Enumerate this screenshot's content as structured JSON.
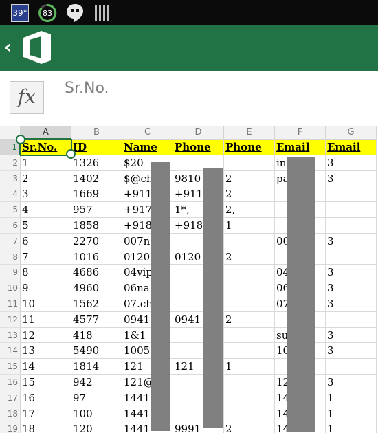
{
  "status_bar": {
    "temperature": "39°",
    "battery_level": "83",
    "icons": [
      "hangouts-icon",
      "signal-bars-icon"
    ]
  },
  "app_bar": {
    "back_icon": "chevron-left-icon",
    "logo_icon": "office-logo-icon",
    "color": "#217346"
  },
  "formula_bar": {
    "fx_label": "fx",
    "value": "Sr.No."
  },
  "sheet": {
    "columns": [
      "A",
      "B",
      "C",
      "D",
      "E",
      "F",
      "G"
    ],
    "active_column": "A",
    "active_row": "1",
    "header_fill": "#ffff00",
    "rows": [
      {
        "num": "1",
        "cells": [
          "Sr.No.",
          "ID",
          "Name",
          "Phone",
          "Phone",
          "Email",
          "Email"
        ]
      },
      {
        "num": "2",
        "cells": [
          "1",
          "1326",
          "$20",
          "",
          "",
          "in",
          "3"
        ]
      },
      {
        "num": "3",
        "cells": [
          "2",
          "1402",
          "$@ch",
          "9810",
          "2",
          "pa",
          "3"
        ]
      },
      {
        "num": "4",
        "cells": [
          "3",
          "1669",
          "+911",
          "+911",
          "2",
          "",
          ""
        ]
      },
      {
        "num": "5",
        "cells": [
          "4",
          "957",
          "+917",
          "1*,",
          "2,",
          "",
          ""
        ]
      },
      {
        "num": "6",
        "cells": [
          "5",
          "1858",
          "+918",
          "+918",
          "1",
          "",
          ""
        ]
      },
      {
        "num": "7",
        "cells": [
          "6",
          "2270",
          "007n",
          "",
          "",
          "00",
          "3"
        ]
      },
      {
        "num": "8",
        "cells": [
          "7",
          "1016",
          "0120",
          "0120",
          "2",
          "",
          ""
        ]
      },
      {
        "num": "9",
        "cells": [
          "8",
          "4686",
          "04vip",
          "",
          "",
          "04",
          "3"
        ]
      },
      {
        "num": "10",
        "cells": [
          "9",
          "4960",
          "06na",
          "",
          "",
          "06",
          "3"
        ]
      },
      {
        "num": "11",
        "cells": [
          "10",
          "1562",
          "07.ch",
          "",
          "",
          "07",
          "3"
        ]
      },
      {
        "num": "12",
        "cells": [
          "11",
          "4577",
          "0941",
          "0941",
          "2",
          "",
          ""
        ]
      },
      {
        "num": "13",
        "cells": [
          "12",
          "418",
          "1&1",
          "",
          "",
          "su",
          "3"
        ]
      },
      {
        "num": "14",
        "cells": [
          "13",
          "5490",
          "1005",
          "",
          "",
          "10",
          "3"
        ]
      },
      {
        "num": "15",
        "cells": [
          "14",
          "1814",
          "121",
          "121",
          "1",
          "",
          ""
        ]
      },
      {
        "num": "16",
        "cells": [
          "15",
          "942",
          "121@",
          "",
          "",
          "12",
          "3"
        ]
      },
      {
        "num": "17",
        "cells": [
          "16",
          "97",
          "1441",
          "",
          "",
          "14",
          "1"
        ]
      },
      {
        "num": "18",
        "cells": [
          "17",
          "100",
          "1441",
          "",
          "",
          "14",
          "1"
        ]
      },
      {
        "num": "19",
        "cells": [
          "18",
          "120",
          "1441",
          "9991",
          "2",
          "14",
          "1"
        ]
      }
    ]
  }
}
